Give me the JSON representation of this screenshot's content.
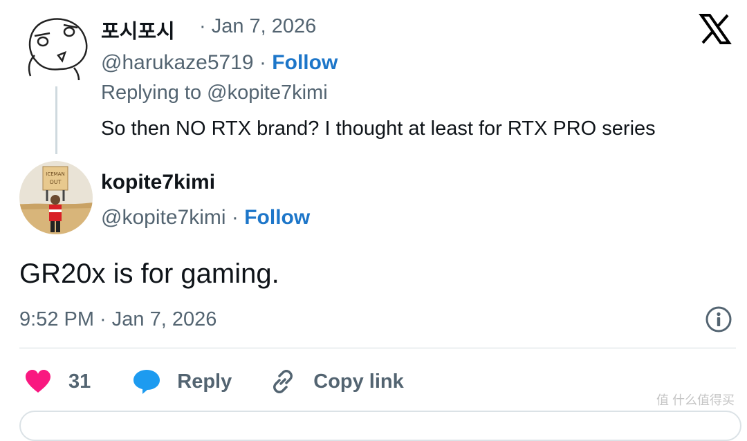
{
  "reply_tweet": {
    "display_name": "포시포시",
    "date": "· Jan 7, 2026",
    "handle": "@harukaze5719",
    "separator": "·",
    "follow_label": "Follow",
    "replying_to": "Replying to @kopite7kimi",
    "text": "So then NO RTX brand? I thought at least for RTX PRO series"
  },
  "main_tweet": {
    "display_name": "kopite7kimi",
    "handle": "@kopite7kimi",
    "separator": "·",
    "follow_label": "Follow",
    "avatar_sign_text": "ICEMAN OUT",
    "text": "GR20x is for gaming.",
    "timestamp": "9:52 PM · Jan 7, 2026"
  },
  "actions": {
    "like_count": "31",
    "reply_label": "Reply",
    "copy_link_label": "Copy link"
  },
  "watermark": "值 什么值得买",
  "colors": {
    "link": "#1d76c9",
    "like": "#f91880",
    "reply": "#1d9bf0",
    "muted": "#536471"
  },
  "icons": [
    "x-logo-icon",
    "info-icon",
    "heart-icon",
    "reply-bubble-icon",
    "link-icon"
  ]
}
